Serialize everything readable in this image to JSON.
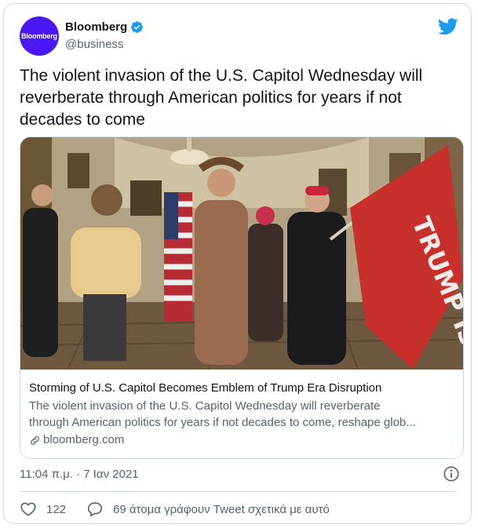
{
  "account": {
    "avatar_text": "Bloomberg",
    "display_name": "Bloomberg",
    "handle": "@business",
    "verified": true,
    "brand_color": "#4a17f5"
  },
  "tweet": {
    "text": "The violent invasion of the U.S. Capitol Wednesday will reverberate through American politics for years if not decades to come"
  },
  "link_card": {
    "image_icon": "photo-capitol-protesters",
    "flag_text": "TRUMP IS MY PRESIDEN",
    "title": "Storming of U.S. Capitol Becomes Emblem of Trump Era Disruption",
    "description_line1": "The violent invasion of the U.S. Capitol Wednesday will reverberate",
    "description_line2": "through American politics for years if not decades to come, reshape glob...",
    "domain": "bloomberg.com"
  },
  "meta": {
    "timestamp": "11:04 π.μ. · 7 Ιαν 2021"
  },
  "actions": {
    "likes": "122",
    "replies_text": "69 άτομα γράφουν Tweet σχετικά με αυτό"
  },
  "colors": {
    "twitter_blue": "#1d9bf0",
    "text_primary": "#0f1419",
    "text_secondary": "#536471",
    "border": "#cfd9de"
  }
}
